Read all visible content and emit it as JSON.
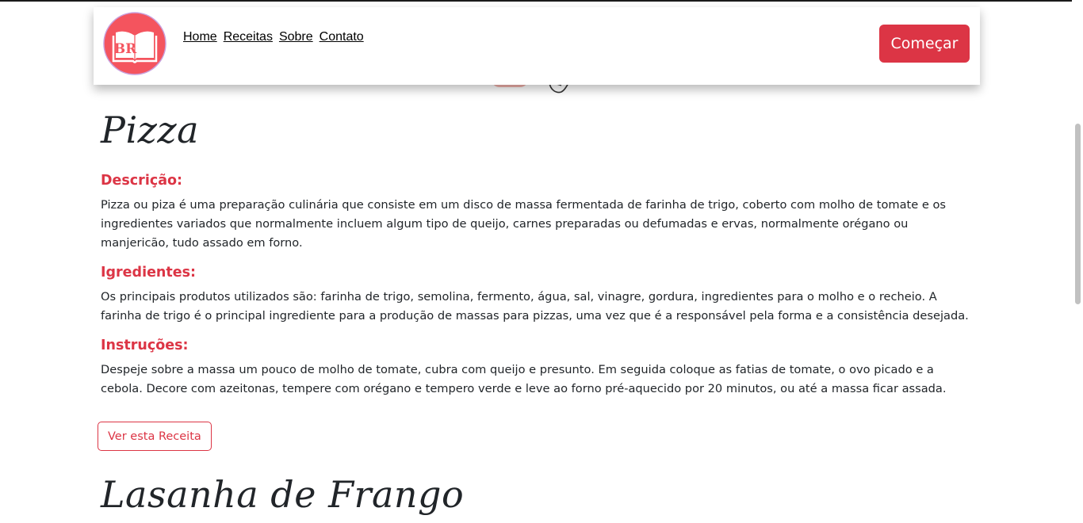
{
  "header": {
    "logo_alt": "BR",
    "nav": [
      {
        "label": "Home"
      },
      {
        "label": "Receitas"
      },
      {
        "label": "Sobre"
      },
      {
        "label": "Contato"
      }
    ],
    "cta_label": "Começar"
  },
  "recipe": {
    "title": "Pizza",
    "description_heading": "Descrição:",
    "description_text": "Pizza ou piza é uma preparação culinária que consiste em um disco de massa fermentada de farinha de trigo, coberto com molho de tomate e os ingredientes variados que normalmente incluem algum tipo de queijo, carnes preparadas ou defumadas e ervas, normalmente orégano ou manjericão, tudo assado em forno.",
    "ingredients_heading": "Igredientes:",
    "ingredients_text": "Os principais produtos utilizados são: farinha de trigo, semolina, fermento, água, sal, vinagre, gordura, ingredientes para o molho e o recheio. A farinha de trigo é o principal ingrediente para a produção de massas para pizzas, uma vez que é a responsável pela forma e a consistência desejada.",
    "instructions_heading": "Instruções:",
    "instructions_text": "Despeje sobre a massa um pouco de molho de tomate, cubra com queijo e presunto. Em seguida coloque as fatias de tomate, o ovo picado e a cebola. Decore com azeitonas, tempere com orégano e tempero verde e leve ao forno pré-aquecido por 20 minutos, ou até a massa ficar assada.",
    "button_label": "Ver esta Receita"
  },
  "next_recipe": {
    "title": "Lasanha de Frango"
  },
  "colors": {
    "accent": "#dc3545",
    "logo_circle": "#f4545e"
  }
}
